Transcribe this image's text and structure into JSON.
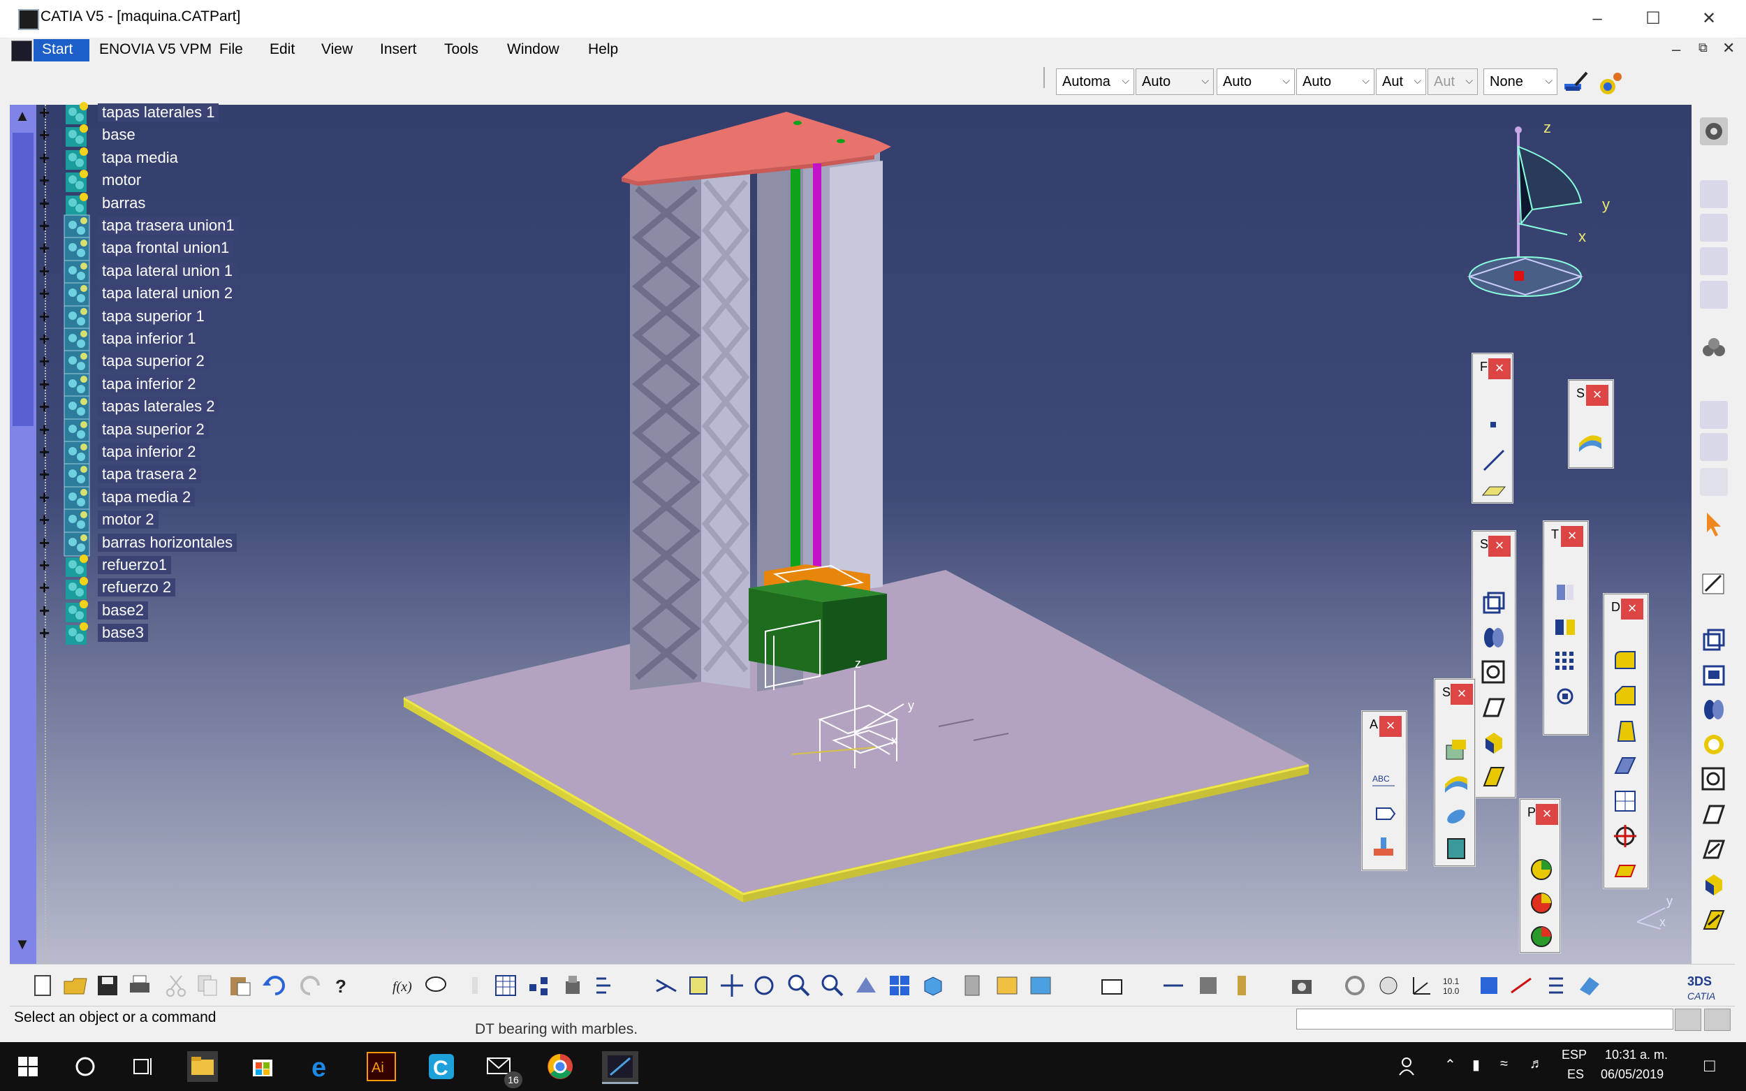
{
  "window": {
    "title": "CATIA V5 - [maquina.CATPart]",
    "controls": [
      "minimize",
      "maximize",
      "close"
    ]
  },
  "menu": {
    "items": [
      "Start",
      "ENOVIA V5 VPM",
      "File",
      "Edit",
      "View",
      "Insert",
      "Tools",
      "Window",
      "Help"
    ],
    "active": "Start"
  },
  "properties_toolbar": {
    "combos": [
      {
        "value": "Automa",
        "disabled": false
      },
      {
        "value": "Auto",
        "disabled": true
      },
      {
        "value": "Auto",
        "disabled": false
      },
      {
        "value": "Auto",
        "disabled": false
      },
      {
        "value": "Aut",
        "disabled": false
      },
      {
        "value": "Aut",
        "disabled": true
      },
      {
        "value": "None",
        "disabled": false
      }
    ]
  },
  "tree": {
    "items": [
      {
        "label": "tapas laterales 1",
        "icon": "geometrical-set-icon",
        "selected": true
      },
      {
        "label": "base",
        "icon": "geometrical-set-icon",
        "selected": false
      },
      {
        "label": "tapa media",
        "icon": "geometrical-set-icon",
        "selected": false
      },
      {
        "label": "motor",
        "icon": "geometrical-set-icon",
        "selected": false
      },
      {
        "label": "barras",
        "icon": "geometrical-set-icon",
        "selected": false
      },
      {
        "label": "tapa trasera union1",
        "icon": "body-icon",
        "selected": true
      },
      {
        "label": "tapa frontal union1",
        "icon": "body-icon",
        "selected": true
      },
      {
        "label": "tapa lateral union 1",
        "icon": "body-icon",
        "selected": true
      },
      {
        "label": "tapa lateral union 2",
        "icon": "body-icon",
        "selected": true
      },
      {
        "label": "tapa superior 1",
        "icon": "body-icon",
        "selected": true
      },
      {
        "label": "tapa inferior 1",
        "icon": "body-icon",
        "selected": true
      },
      {
        "label": "tapa superior 2",
        "icon": "body-icon",
        "selected": true
      },
      {
        "label": "tapa inferior 2",
        "icon": "body-icon",
        "selected": true
      },
      {
        "label": "tapas laterales 2",
        "icon": "body-icon",
        "selected": true
      },
      {
        "label": "tapa superior 2",
        "icon": "body-icon",
        "selected": true
      },
      {
        "label": "tapa inferior 2",
        "icon": "body-icon",
        "selected": true
      },
      {
        "label": "tapa trasera 2",
        "icon": "body-icon",
        "selected": true
      },
      {
        "label": "tapa media 2",
        "icon": "body-icon",
        "selected": true
      },
      {
        "label": "motor 2",
        "icon": "body-icon",
        "selected": true
      },
      {
        "label": "barras horizontales",
        "icon": "body-icon",
        "selected": true
      },
      {
        "label": "refuerzo1",
        "icon": "geometrical-set-icon",
        "selected": true
      },
      {
        "label": "refuerzo 2",
        "icon": "geometrical-set-icon",
        "selected": true
      },
      {
        "label": "base2",
        "icon": "geometrical-set-icon",
        "selected": true
      },
      {
        "label": "base3",
        "icon": "geometrical-set-icon",
        "selected": true
      }
    ]
  },
  "compass": {
    "axis_labels": [
      "z",
      "y",
      "x"
    ]
  },
  "model_axes": {
    "labels": [
      "z",
      "y",
      "x"
    ]
  },
  "mini_axes": {
    "labels": [
      "y",
      "x"
    ]
  },
  "palettes": [
    {
      "letter": "F",
      "name": "wireframe-palette",
      "tools": [
        "point-icon",
        "line-icon",
        "plane-icon"
      ]
    },
    {
      "letter": "S",
      "name": "surfaces-palette",
      "tools": [
        "surface-icon"
      ]
    },
    {
      "letter": "S",
      "name": "sketch-based-palette",
      "tools": [
        "pad-icon",
        "pocket-icon",
        "hole-icon",
        "rib-icon",
        "solid-icon",
        "stiffener-icon"
      ]
    },
    {
      "letter": "T",
      "name": "transformation-palette",
      "tools": [
        "translation-icon",
        "mirror-icon",
        "pattern-icon",
        "scaling-icon"
      ]
    },
    {
      "letter": "D",
      "name": "dress-up-palette",
      "tools": [
        "fillet-icon",
        "chamfer-icon",
        "draft-icon",
        "shell-icon",
        "thickness-icon",
        "thread-icon",
        "remove-face-icon"
      ]
    },
    {
      "letter": "S",
      "name": "surface-based-palette",
      "tools": [
        "split-icon",
        "thick-surface-icon",
        "close-surface-icon",
        "sew-surface-icon"
      ]
    },
    {
      "letter": "A",
      "name": "annotations-palette",
      "tools": [
        "text-icon",
        "flag-note-icon",
        "stamp-icon"
      ]
    },
    {
      "letter": "P",
      "name": "analysis-palette",
      "tools": [
        "draft-analysis-icon",
        "curvature-analysis-icon",
        "deviation-icon"
      ]
    }
  ],
  "status": {
    "message": "Select an object or a command",
    "behind_text": "DT bearing with marbles."
  },
  "taskbar": {
    "language_top": "ESP",
    "language_bottom": "ES",
    "time": "10:31 a. m.",
    "date": "06/05/2019",
    "mail_badge": "16"
  },
  "colors": {
    "viewport_top": "#343e6c",
    "tree_selection": "#3b4374",
    "floor": "#b3a3c0",
    "tower": "#b9bad2",
    "top_plate": "#e7736c",
    "green_rod": "#0ea31a",
    "magenta_rod": "#c412c8",
    "motor_green": "#1e6d1f",
    "orange_block": "#e8860c"
  }
}
